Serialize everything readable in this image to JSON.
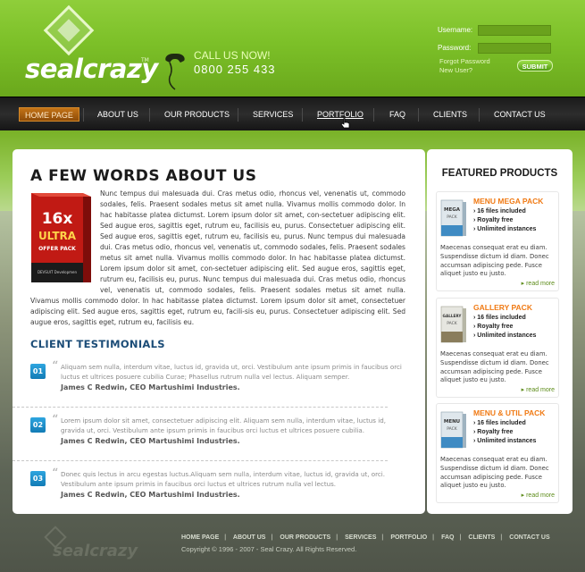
{
  "brand": {
    "name": "sealcrazy",
    "tm": "TM"
  },
  "call": {
    "label": "CALL US NOW!",
    "number": "0800 255 433"
  },
  "login": {
    "username_label": "Username:",
    "password_label": "Password:",
    "forgot": "Forgot Password",
    "new_user": "New User?",
    "submit": "SUBMIT"
  },
  "nav": {
    "items": [
      {
        "label": "HOME PAGE",
        "state": "active"
      },
      {
        "label": "ABOUT US"
      },
      {
        "label": "OUR PRODUCTS"
      },
      {
        "label": "SERVICES"
      },
      {
        "label": "PORTFOLIO",
        "state": "hovered"
      },
      {
        "label": "FAQ"
      },
      {
        "label": "CLIENTS"
      },
      {
        "label": "CONTACT US"
      }
    ]
  },
  "about": {
    "title": "A FEW WORDS ABOUT US",
    "product_box": {
      "line1": "16x",
      "line2": "ULTRA",
      "line3": "OFFER PACK",
      "line4": "DEVSUIT Developmen"
    },
    "text": "Nunc tempus dui malesuada dui. Cras metus odio, rhoncus vel, venenatis ut, commodo sodales, felis. Praesent sodales metus sit amet nulla. Vivamus mollis commodo dolor. In hac habitasse platea dictumst. Lorem ipsum dolor sit amet, con-sectetuer adipiscing elit. Sed augue eros, sagittis eget, rutrum eu, facilisis eu, purus. Consectetuer adipiscing elit. Sed augue eros, sagittis eget, rutrum eu, facilisis eu, purus. Nunc tempus dui malesuada dui. Cras metus odio, rhoncus vel, venenatis ut, commodo sodales, felis. Praesent sodales metus sit amet nulla. Vivamus mollis commodo dolor. In hac habitasse platea dictumst. Lorem ipsum dolor sit amet, con-sectetuer adipiscing elit. Sed augue eros, sagittis eget, rutrum eu, facilisis eu, purus. Nunc tempus dui malesuada dui. Cras metus odio, rhoncus vel, venenatis ut, commodo sodales, felis. Praesent sodales metus sit amet nulla. Vivamus mollis commodo dolor. In hac habitasse platea dictumst. Lorem ipsum dolor sit amet, consectetuer adipiscing elit. Sed augue eros, sagittis eget, rutrum eu, facili-sis eu, purus. Consectetuer adipiscing elit. Sed augue eros, sagittis eget, rutrum eu, facilisis eu."
  },
  "testimonials": {
    "title": "CLIENT TESTIMONIALS",
    "items": [
      {
        "num": "01",
        "text": "Aliquam sem nulla, interdum vitae, luctus id, gravida ut, orci. Vestibulum ante ipsum primis in faucibus orci luctus et ultrices posuere cubilia Curae; Phasellus rutrum nulla vel lectus. Aliquam semper.",
        "author": "James C Redwin, CEO Martushimi Industries."
      },
      {
        "num": "02",
        "text": "Lorem ipsum dolor sit amet, consectetuer adipiscing elit. Aliquam sem nulla, interdum vitae, luctus id, gravida ut, orci. Vestibulum ante ipsum primis in faucibus orci luctus et ultrices posuere cubilia.",
        "author": "James C Redwin, CEO Martushimi Industries."
      },
      {
        "num": "03",
        "text": "Donec quis lectus in arcu egestas luctus.Aliquam sem nulla, interdum vitae, luctus id, gravida ut, orci. Vestibulum ante ipsum primis in faucibus orci luctus et ultrices rutrum nulla vel lectus.",
        "author": "James C Redwin, CEO Martushimi Industries."
      }
    ]
  },
  "featured": {
    "title": "FEATURED PRODUCTS",
    "products": [
      {
        "name": "MENU MEGA PACK",
        "box_label": "MEGA",
        "box_sub": "PACK",
        "features": [
          "16 files included",
          "Royalty free",
          "Unlimited instances"
        ],
        "desc": "Maecenas consequat erat eu diam. Suspendisse dictum id diam. Donec accumsan adipiscing pede. Fusce aliquet justo eu justo.",
        "more": "read more"
      },
      {
        "name": "GALLERY PACK",
        "box_label": "GALLERY",
        "box_sub": "PACK",
        "features": [
          "16 files included",
          "Royalty free",
          "Unlimited instances"
        ],
        "desc": "Maecenas consequat erat eu diam. Suspendisse dictum id diam. Donec accumsan adipiscing pede. Fusce aliquet justo eu justo.",
        "more": "read more"
      },
      {
        "name": "MENU & UTIL PACK",
        "box_label": "MENU",
        "box_sub": "PACK",
        "features": [
          "16 files included",
          "Royalty free",
          "Unlimited instances"
        ],
        "desc": "Maecenas consequat erat eu diam. Suspendisse dictum id diam. Donec accumsan adipiscing pede. Fusce aliquet justo eu justo.",
        "more": "read more"
      }
    ]
  },
  "footer": {
    "brand": "sealcrazy",
    "links": [
      "HOME PAGE",
      "ABOUT US",
      "OUR PRODUCTS",
      "SERVICES",
      "PORTFOLIO",
      "FAQ",
      "CLIENTS",
      "CONTACT US"
    ],
    "copyright": "Copyright © 1996 - 2007 - Seal Crazy.  All Rights Reserved."
  },
  "colors": {
    "green": "#7cc028",
    "orange": "#f07a14",
    "blue": "#1b4c77",
    "nav_active": "#c47316"
  }
}
